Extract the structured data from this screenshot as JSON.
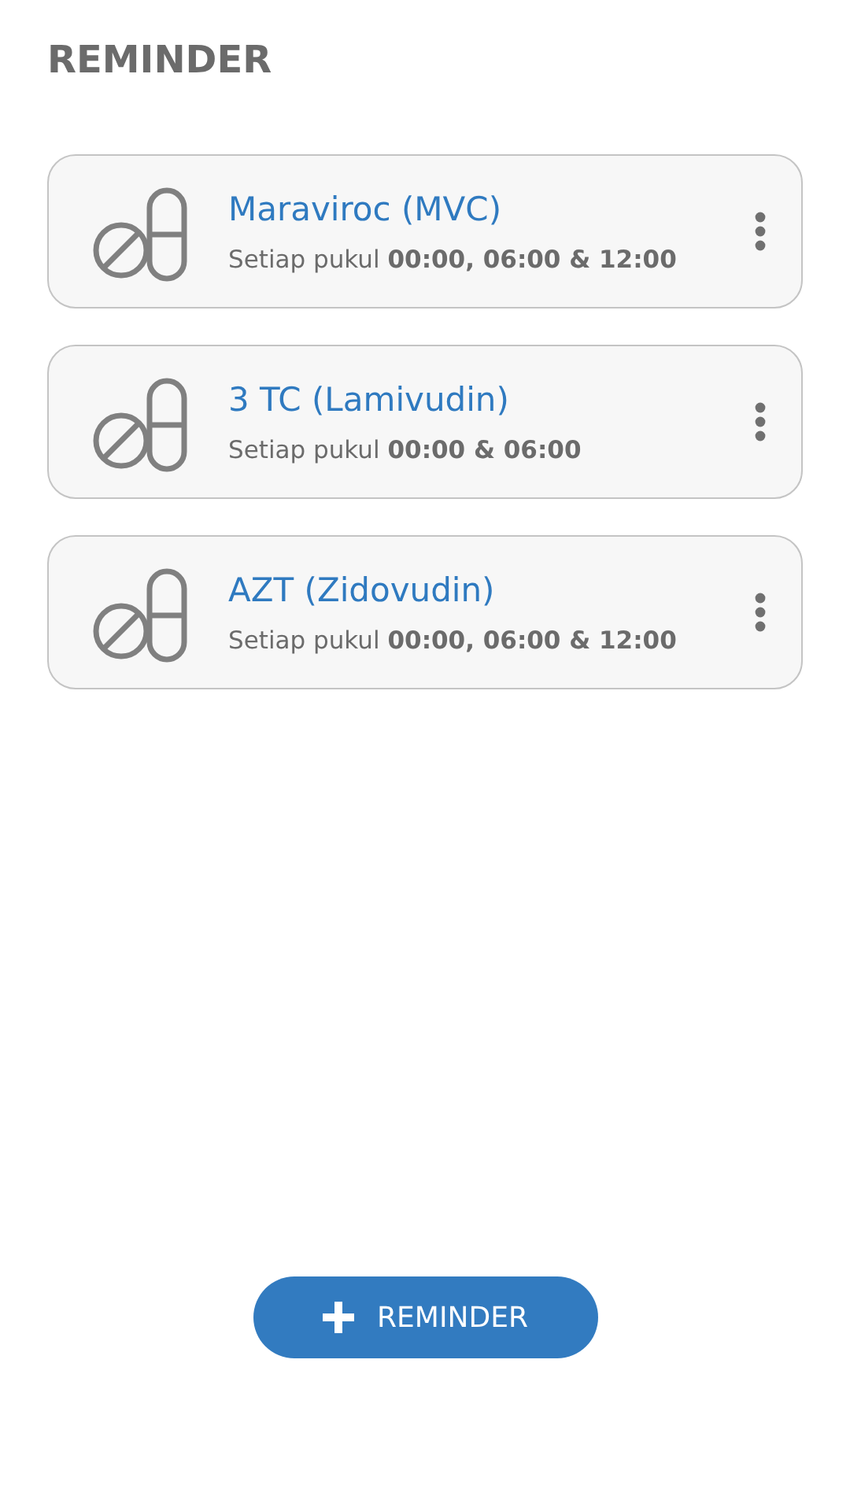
{
  "title": "REMINDER",
  "reminders": [
    {
      "name": "Maraviroc (MVC)",
      "schedule": "Setiap pukul **00:00, 06:00 & 12:00**"
    },
    {
      "name": "3 TC (Lamivudin)",
      "schedule": "Setiap pukul **00:00 & 06:00**"
    },
    {
      "name": "AZT (Zidovudin)",
      "schedule": "Setiap pukul **00:00, 06:00 & 12:00**"
    }
  ],
  "add_button": {
    "label": "REMINDER"
  }
}
